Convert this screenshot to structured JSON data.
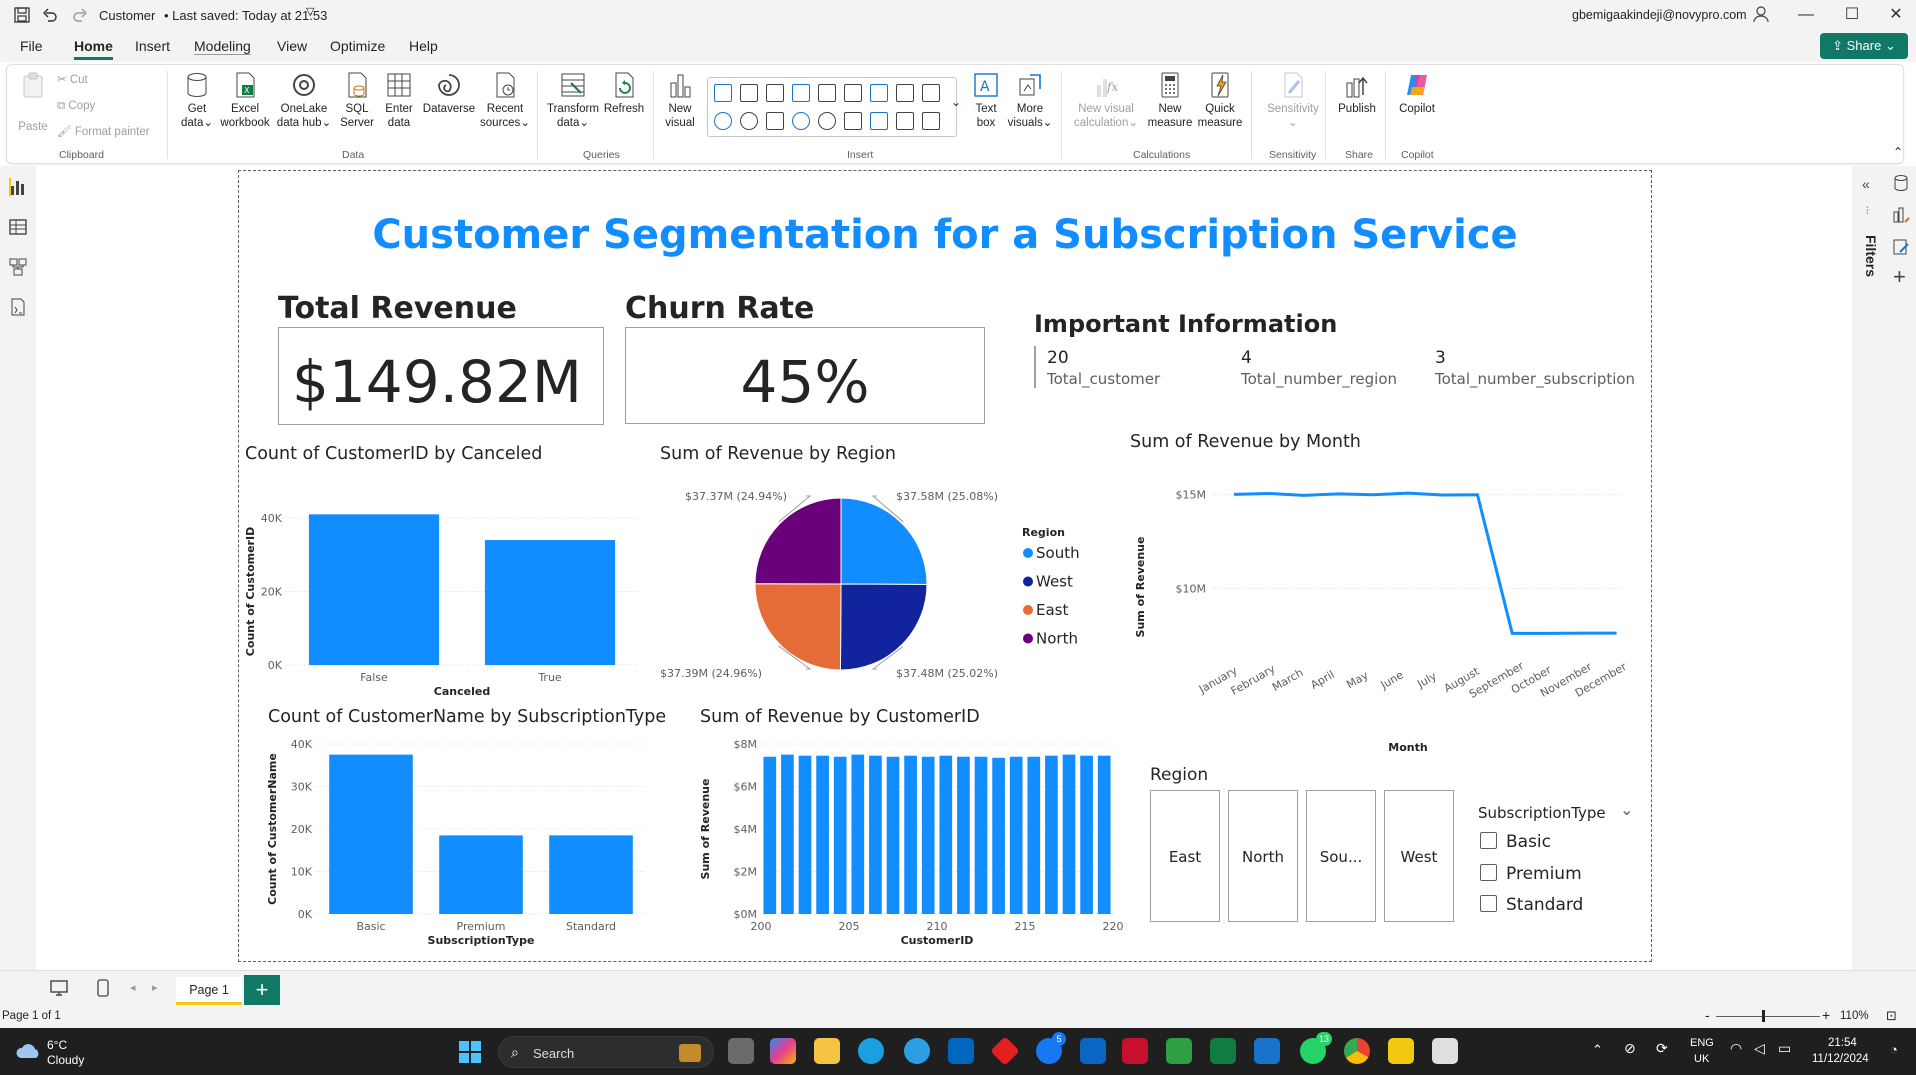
{
  "titlebar": {
    "doc": "Customer",
    "saved": "• Last saved: Today at 21:53",
    "user": "gbemigaakindeji@novypro.com"
  },
  "menu": {
    "items": [
      "File",
      "Home",
      "Insert",
      "Modeling",
      "View",
      "Optimize",
      "Help"
    ],
    "share": "Share"
  },
  "ribbon": {
    "clipboard": {
      "paste": "Paste",
      "cut": "Cut",
      "copy": "Copy",
      "format_painter": "Format painter",
      "group": "Clipboard"
    },
    "data": {
      "get_data": [
        "Get",
        "data"
      ],
      "excel": [
        "Excel",
        "workbook"
      ],
      "onelake": [
        "OneLake",
        "data hub"
      ],
      "sql": [
        "SQL",
        "Server"
      ],
      "enter": [
        "Enter",
        "data"
      ],
      "dataverse": [
        "Dataverse",
        ""
      ],
      "recent": [
        "Recent",
        "sources"
      ],
      "group": "Data"
    },
    "queries": {
      "transform": [
        "Transform",
        "data"
      ],
      "refresh": "Refresh",
      "group": "Queries"
    },
    "insert": {
      "new_visual": [
        "New",
        "visual"
      ],
      "text_box": [
        "Text",
        "box"
      ],
      "more_visuals": [
        "More",
        "visuals"
      ],
      "group": "Insert"
    },
    "calculations": {
      "new_visual_calc": [
        "New visual",
        "calculation"
      ],
      "new_measure": [
        "New",
        "measure"
      ],
      "quick_measure": [
        "Quick",
        "measure"
      ],
      "group": "Calculations"
    },
    "sensitivity": {
      "label": "Sensitivity",
      "group": "Sensitivity"
    },
    "share": {
      "publish": "Publish",
      "group": "Share"
    },
    "copilot": {
      "label": "Copilot",
      "group": "Copilot"
    }
  },
  "filters_label": "Filters",
  "report": {
    "title": "Customer Segmentation for a Subscription Service",
    "total_revenue": {
      "head": "Total Revenue",
      "value": "$149.82M"
    },
    "churn_rate": {
      "head": "Churn Rate",
      "value": "45%"
    },
    "important": {
      "head": "Important Information",
      "items": [
        {
          "value": "20",
          "label": "Total_customer"
        },
        {
          "value": "4",
          "label": "Total_number_region"
        },
        {
          "value": "3",
          "label": "Total_number_subscription"
        }
      ]
    },
    "slicer_region": {
      "title": "Region",
      "options": [
        "East",
        "North",
        "Sou...",
        "West"
      ]
    },
    "slicer_sub": {
      "title": "SubscriptionType",
      "options": [
        "Basic",
        "Premium",
        "Standard"
      ]
    }
  },
  "chart_data": [
    {
      "type": "bar",
      "title": "Count of CustomerID by Canceled",
      "categories": [
        "False",
        "True"
      ],
      "values": [
        41000,
        34000
      ],
      "xlabel": "Canceled",
      "ylabel": "Count of CustomerID",
      "ylim": [
        0,
        40000
      ],
      "yticks": [
        "0K",
        "20K",
        "40K"
      ],
      "color": "#118DFF"
    },
    {
      "type": "pie",
      "title": "Sum of Revenue by Region",
      "legend_title": "Region",
      "slices": [
        {
          "name": "South",
          "value": 37.58,
          "label": "$37.58M (25.08%)",
          "color": "#118DFF"
        },
        {
          "name": "West",
          "value": 37.48,
          "label": "$37.48M (25.02%)",
          "color": "#12239E"
        },
        {
          "name": "East",
          "value": 37.39,
          "label": "$37.39M (24.96%)",
          "color": "#E66C37"
        },
        {
          "name": "North",
          "value": 37.37,
          "label": "$37.37M (24.94%)",
          "color": "#6B007B"
        }
      ]
    },
    {
      "type": "line",
      "title": "Sum of Revenue by Month",
      "categories": [
        "January",
        "February",
        "March",
        "April",
        "May",
        "June",
        "July",
        "August",
        "September",
        "October",
        "November",
        "December"
      ],
      "values": [
        15.0,
        15.05,
        14.95,
        15.03,
        14.98,
        15.07,
        14.97,
        14.98,
        7.62,
        7.62,
        7.63,
        7.63
      ],
      "xlabel": "Month",
      "ylabel": "Sum of Revenue",
      "ylim": [
        7.0,
        15.5
      ],
      "yticks": [
        {
          "v": 15,
          "t": "$15M"
        },
        {
          "v": 10,
          "t": "$10M"
        }
      ],
      "color": "#118DFF"
    },
    {
      "type": "bar",
      "title": "Count of CustomerName by SubscriptionType",
      "categories": [
        "Basic",
        "Premium",
        "Standard"
      ],
      "values": [
        37500,
        18500,
        18500
      ],
      "xlabel": "SubscriptionType",
      "ylabel": "Count of CustomerName",
      "ylim": [
        0,
        40000
      ],
      "yticks": [
        "0K",
        "10K",
        "20K",
        "30K",
        "40K"
      ],
      "color": "#118DFF"
    },
    {
      "type": "bar",
      "title": "Sum of Revenue by CustomerID",
      "x": [
        201,
        202,
        203,
        204,
        205,
        206,
        207,
        208,
        209,
        210,
        211,
        212,
        213,
        214,
        215,
        216,
        217,
        218,
        219,
        220
      ],
      "values": [
        7.4,
        7.5,
        7.45,
        7.45,
        7.4,
        7.5,
        7.45,
        7.4,
        7.45,
        7.4,
        7.45,
        7.4,
        7.4,
        7.35,
        7.4,
        7.4,
        7.45,
        7.5,
        7.45,
        7.45
      ],
      "xlabel": "CustomerID",
      "ylabel": "Sum of Revenue",
      "ylim": [
        0,
        8
      ],
      "yticks": [
        "$0M",
        "$2M",
        "$4M",
        "$6M",
        "$8M"
      ],
      "xticks": [
        200,
        205,
        210,
        215,
        220
      ],
      "color": "#118DFF"
    }
  ],
  "pages": {
    "current": "Page 1",
    "status": "Page 1 of 1",
    "zoom": "110%"
  },
  "taskbar": {
    "weather_temp": "6°C",
    "weather_desc": "Cloudy",
    "search": "Search",
    "lang1": "ENG",
    "lang2": "UK",
    "time": "21:54",
    "date": "11/12/2024",
    "badge1": "5",
    "badge2": "13"
  }
}
